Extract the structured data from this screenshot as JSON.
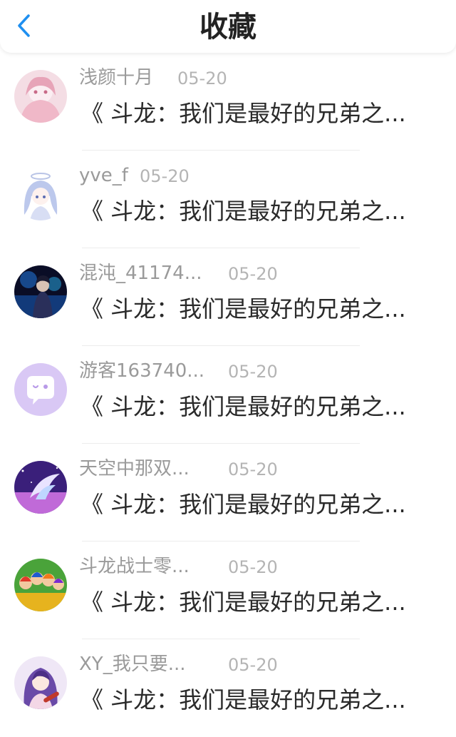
{
  "header": {
    "title": "收藏",
    "back_icon": "chevron-left-icon",
    "accent_color": "#1e8ff0"
  },
  "items": [
    {
      "name": "浅颜十月",
      "date": "05-20",
      "snippet": "《 斗龙：我们是最好的兄弟之...",
      "avatar": "anime-girl-pink-avatar"
    },
    {
      "name": "yve_f",
      "date": "05-20",
      "snippet": "《 斗龙：我们是最好的兄弟之...",
      "avatar": "anime-girl-blue-hair-avatar"
    },
    {
      "name": "混沌_41174...",
      "date": "05-20",
      "snippet": "《 斗龙：我们是最好的兄弟之...",
      "avatar": "dark-blue-character-avatar"
    },
    {
      "name": "游客163740...",
      "date": "05-20",
      "snippet": "《 斗龙：我们是最好的兄弟之...",
      "avatar": "default-chat-bubble-avatar"
    },
    {
      "name": "天空中那双...",
      "date": "05-20",
      "snippet": "《 斗龙：我们是最好的兄弟之...",
      "avatar": "purple-wing-avatar"
    },
    {
      "name": "斗龙战士零...",
      "date": "05-20",
      "snippet": "《 斗龙：我们是最好的兄弟之...",
      "avatar": "cartoon-group-avatar"
    },
    {
      "name": "XY_我只要...",
      "date": "05-20",
      "snippet": "《 斗龙：我们是最好的兄弟之...",
      "avatar": "anime-girl-guitar-avatar"
    }
  ]
}
